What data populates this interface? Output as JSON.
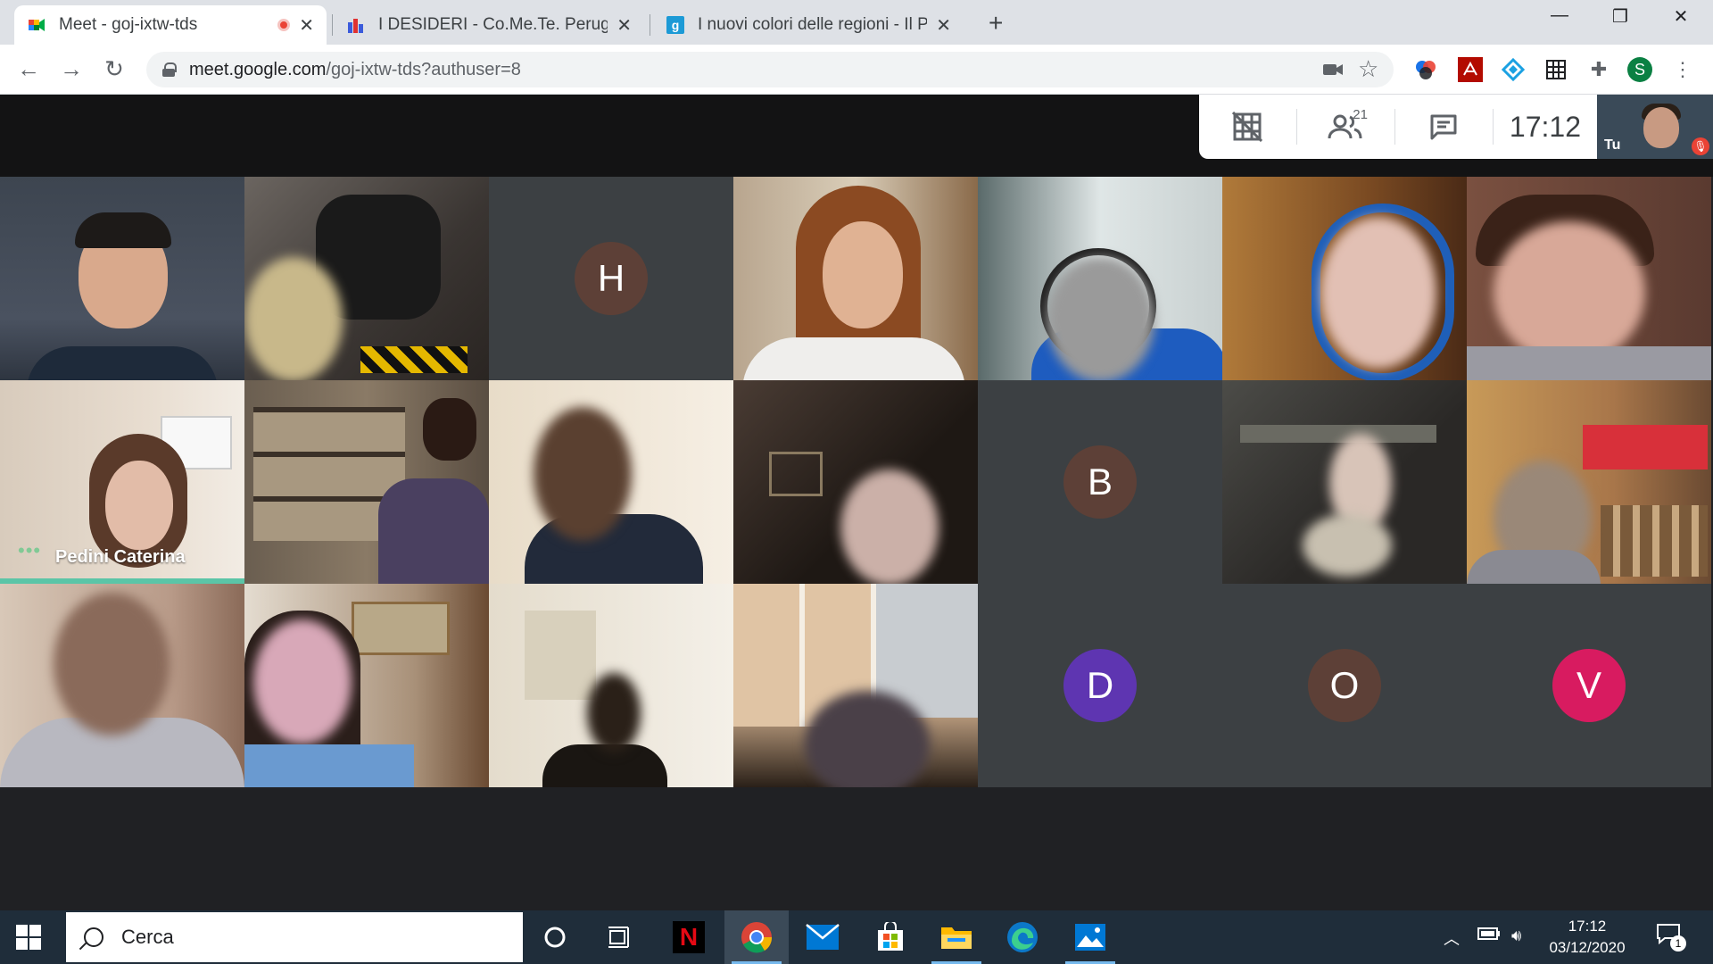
{
  "browser": {
    "tabs": [
      {
        "title": "Meet - goj-ixtw-tds",
        "active": true,
        "recording": true
      },
      {
        "title": "I DESIDERI - Co.Me.Te. Perugia - I",
        "active": false
      },
      {
        "title": "I nuovi colori delle regioni - Il Po",
        "active": false
      }
    ],
    "new_tab": "+",
    "url_host": "meet.google.com",
    "url_path": "/goj-ixtw-tds?authuser=8",
    "profile_initial": "S"
  },
  "meet": {
    "participant_count": "21",
    "clock": "17:12",
    "self_label": "Tu",
    "speaker_name": "Pedini Caterina",
    "speaker_dots": "•••",
    "avatars": [
      {
        "letter": "H",
        "color": "#5d4037"
      },
      {
        "letter": "B",
        "color": "#5d4037"
      },
      {
        "letter": "D",
        "color": "#5e35b1"
      },
      {
        "letter": "O",
        "color": "#5d4037"
      },
      {
        "letter": "V",
        "color": "#d81b60"
      }
    ]
  },
  "taskbar": {
    "search_placeholder": "Cerca",
    "time": "17:12",
    "date": "03/12/2020",
    "notification_count": "1"
  }
}
